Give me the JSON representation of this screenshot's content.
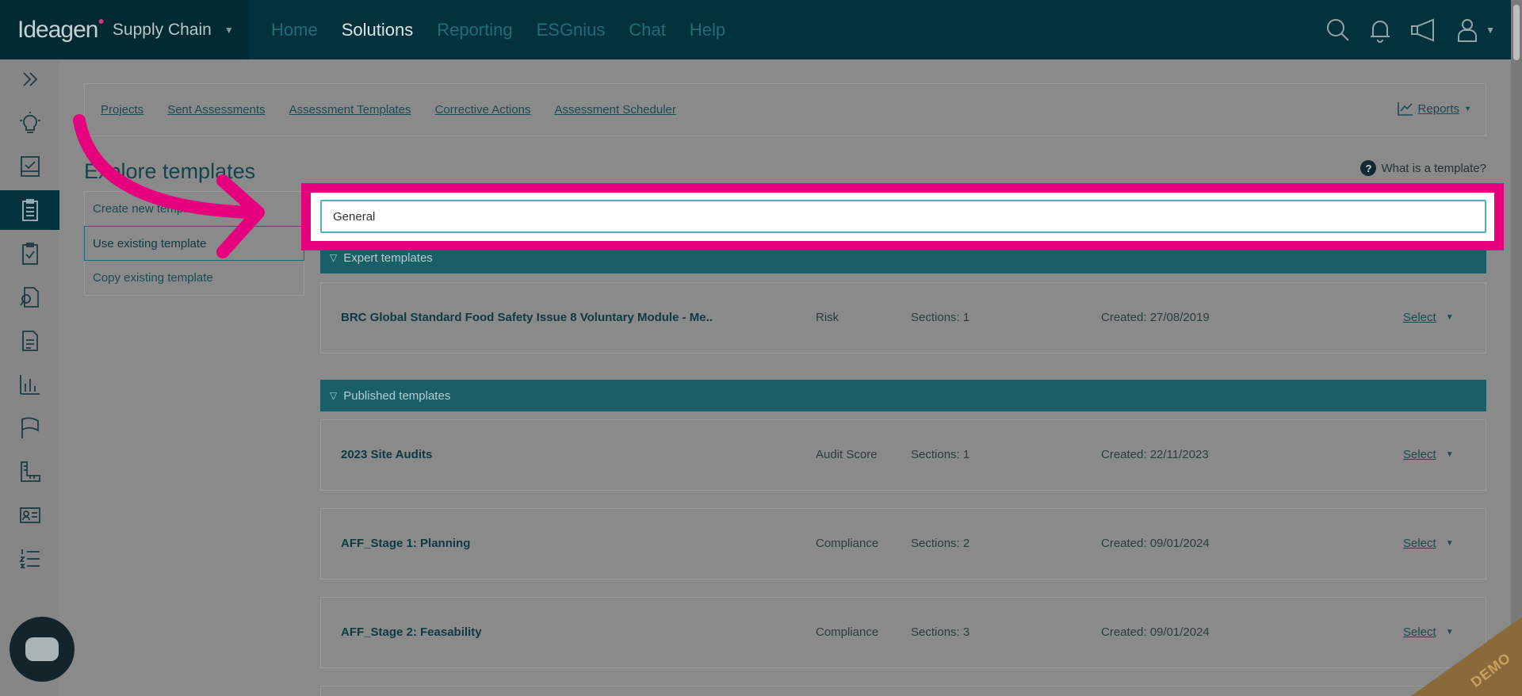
{
  "header": {
    "logo": "Ideagen",
    "product": "Supply Chain",
    "nav": [
      {
        "label": "Home"
      },
      {
        "label": "Solutions"
      },
      {
        "label": "Reporting"
      },
      {
        "label": "ESGnius"
      },
      {
        "label": "Chat"
      },
      {
        "label": "Help"
      }
    ],
    "active_nav": "Solutions"
  },
  "subnav": {
    "links": [
      "Projects",
      "Sent Assessments",
      "Assessment Templates",
      "Corrective Actions",
      "Assessment Scheduler"
    ],
    "reports_label": "Reports"
  },
  "page": {
    "title": "Explore templates",
    "help_label": "What is a template?",
    "options": [
      "Create new template",
      "Use existing template",
      "Copy existing template"
    ],
    "active_option": "Use existing template"
  },
  "search": {
    "value": "General",
    "placeholder": ""
  },
  "sections": {
    "expert": {
      "title": "Expert templates",
      "rows": [
        {
          "name": "BRC Global Standard Food Safety Issue 8 Voluntary Module - Me...",
          "category": "Risk",
          "sections": "Sections: 1",
          "created": "Created: 27/08/2019",
          "action": "Select"
        }
      ]
    },
    "published": {
      "title": "Published templates",
      "rows": [
        {
          "name": "2023 Site Audits",
          "category": "Audit Score",
          "sections": "Sections: 1",
          "created": "Created: 22/11/2023",
          "action": "Select"
        },
        {
          "name": "AFF_Stage 1: Planning",
          "category": "Compliance",
          "sections": "Sections: 2",
          "created": "Created: 09/01/2024",
          "action": "Select"
        },
        {
          "name": "AFF_Stage 2: Feasability",
          "category": "Compliance",
          "sections": "Sections: 3",
          "created": "Created: 09/01/2024",
          "action": "Select"
        }
      ]
    }
  },
  "watermark": "DEMO",
  "colors": {
    "highlight": "#e6007e",
    "topbar": "#03323d",
    "section_header": "#1a5e66"
  }
}
